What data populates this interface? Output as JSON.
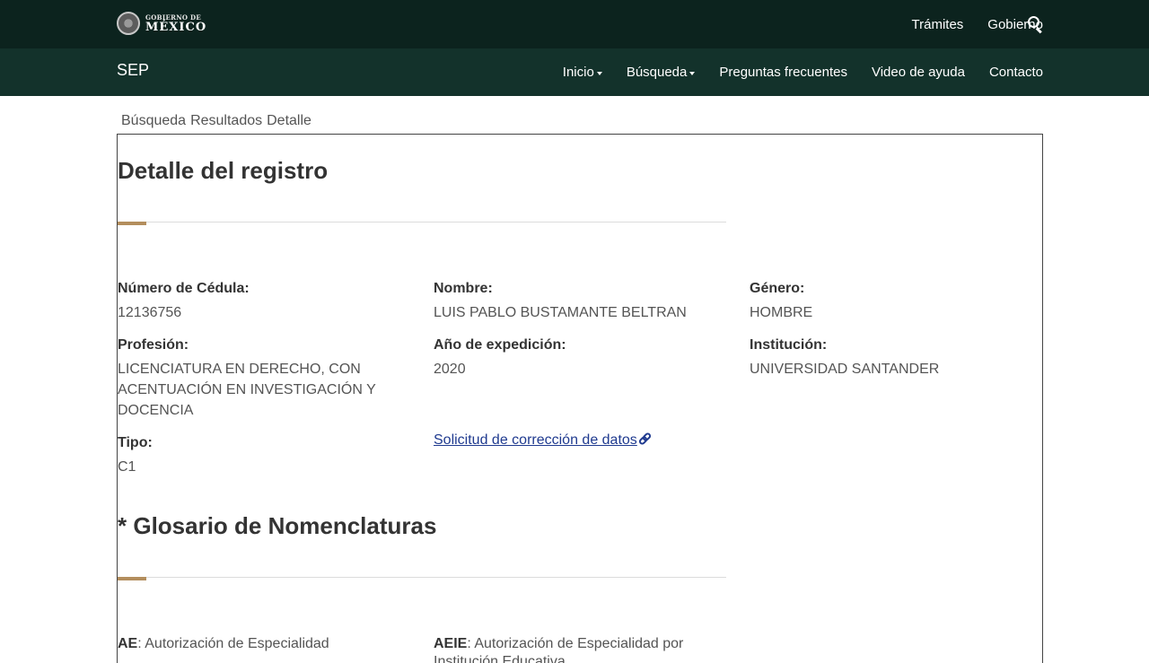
{
  "top_bar": {
    "logo_small": "GOBIERNO DE",
    "logo_big": "MÉXICO",
    "links": [
      "Trámites",
      "Gobierno"
    ],
    "search_icon": "search-icon"
  },
  "nav_bar": {
    "brand": "SEP",
    "items": [
      {
        "label": "Inicio",
        "dropdown": true
      },
      {
        "label": "Búsqueda",
        "dropdown": true
      },
      {
        "label": "Preguntas frecuentes",
        "dropdown": false
      },
      {
        "label": "Video de ayuda",
        "dropdown": false
      },
      {
        "label": "Contacto",
        "dropdown": false
      }
    ]
  },
  "breadcrumb": [
    "Búsqueda",
    "Resultados",
    "Detalle"
  ],
  "detail": {
    "title": "Detalle del registro",
    "fields": {
      "cedula": {
        "label": "Número de Cédula:",
        "value": "12136756"
      },
      "nombre": {
        "label": "Nombre:",
        "value": "LUIS PABLO BUSTAMANTE BELTRAN"
      },
      "genero": {
        "label": "Género:",
        "value": "HOMBRE"
      },
      "profesion": {
        "label": "Profesión:",
        "value": "LICENCIATURA EN DERECHO, CON ACENTUACIÓN EN INVESTIGACIÓN Y DOCENCIA"
      },
      "anio": {
        "label": "Año de expedición:",
        "value": "2020"
      },
      "institucion": {
        "label": "Institución:",
        "value": "UNIVERSIDAD SANTANDER"
      },
      "tipo": {
        "label": "Tipo:",
        "value": "C1"
      }
    },
    "correction_link": "Solicitud de corrección de datos"
  },
  "glossary": {
    "title": "* Glosario de Nomenclaturas",
    "items": [
      {
        "code": "AE",
        "text": ": Autorización de Especialidad"
      },
      {
        "code": "AEIE",
        "text": ": Autorización de Especialidad por Institución Educativa"
      }
    ]
  },
  "colors": {
    "top_bar": "#0c231e",
    "nav_bar": "#13322b",
    "accent": "#b38e5d",
    "link": "#1f3a8f"
  }
}
